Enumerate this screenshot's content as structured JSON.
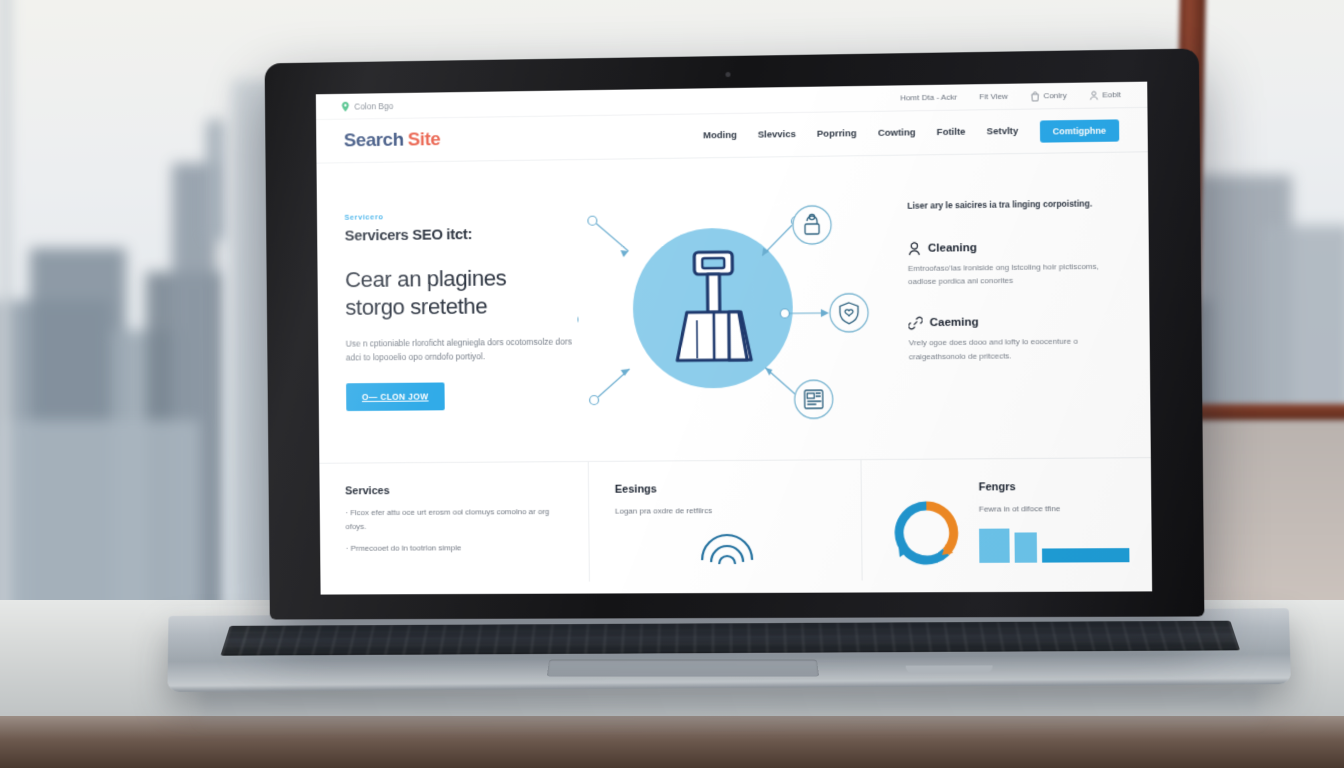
{
  "scene": {
    "device": "macbook-laptop",
    "setting": "office-desk-window-cityscape"
  },
  "site": {
    "utility_bar": {
      "location_label": "Colon Bgo",
      "location_icon": "map-pin-icon",
      "items": [
        {
          "label": "Homt Dta - Ackr",
          "icon": "none"
        },
        {
          "label": "Fit View",
          "icon": "none"
        },
        {
          "label": "Conlry",
          "icon": "bag-icon"
        },
        {
          "label": "Eoblt",
          "icon": "user-icon"
        }
      ]
    },
    "navbar": {
      "logo_first": "Search",
      "logo_second": "Site",
      "links": [
        "Moding",
        "Slevvics",
        "Poprring",
        "Cowting",
        "Fotilte",
        "Setvlty"
      ],
      "cta_label": "Comtigphne"
    },
    "hero": {
      "eyebrow": "Servicero",
      "subheading": "Servicers SEO itct:",
      "heading_line1": "Cear an plagines",
      "heading_line2": "storgo sretethe",
      "body": "Use n cptioniable rloroficht alegniegla dors ocotomsolze dors adci to lopooelio opo orndofo portiyol.",
      "button_label": "O— CLON JOW"
    },
    "illustration": {
      "center_icon": "broom-cleaning-icon",
      "circle_color": "#8dcdeb",
      "line_color": "#1f3a6e",
      "orbit_icons": [
        "lock-user-icon",
        "shield-heart-icon",
        "document-news-icon"
      ]
    },
    "features": {
      "lead": "Liser ary le saicires ia tra linging corpoisting.",
      "items": [
        {
          "icon": "person-icon",
          "title": "Cleaning",
          "text": "Emtroofaso'las lroniside ong lstcoling hoir pictiscoms, oadlose pordica ani conorites"
        },
        {
          "icon": "link-icon",
          "title": "Caeming",
          "text": "Vrely ogoe does dooo and lofty lo eoocenture o craigeathsonolo de pritcects."
        }
      ]
    },
    "cards": [
      {
        "title": "Services",
        "type": "bullets",
        "bullets": [
          "· Flcox efer attu oce urt erosm ool clomuys comolno ar org ofoys.",
          "· Prmecooet do ln tootrlon simple"
        ]
      },
      {
        "title": "Eesings",
        "type": "text-chart",
        "text": "Logan pra oxdre de retfilrcs"
      },
      {
        "title": "Fengrs",
        "type": "bar-chart",
        "text": "Fewra in ot difoce tfine"
      }
    ]
  },
  "chart_data": [
    {
      "type": "pie",
      "title": "",
      "labels": [
        "segment-blue",
        "segment-orange"
      ],
      "values": [
        60,
        40
      ],
      "colors": [
        "#2196cf",
        "#f08a24"
      ],
      "style": "donut-cycle-arrows"
    },
    {
      "type": "bar",
      "title": "Fengrs",
      "categories": [
        "bar-1",
        "bar-2",
        "bar-3"
      ],
      "values": [
        34,
        30,
        14
      ],
      "colors": [
        "#6cc5ec",
        "#6cc5ec",
        "#1f9ed8"
      ],
      "xlabel": "",
      "ylabel": "",
      "grid": false
    }
  ],
  "colors": {
    "accent_blue": "#2aa8e8",
    "logo_navy": "#1f3a6e",
    "logo_red": "#e8513a",
    "circle_blue": "#8dcdeb",
    "orange": "#f08a24"
  }
}
